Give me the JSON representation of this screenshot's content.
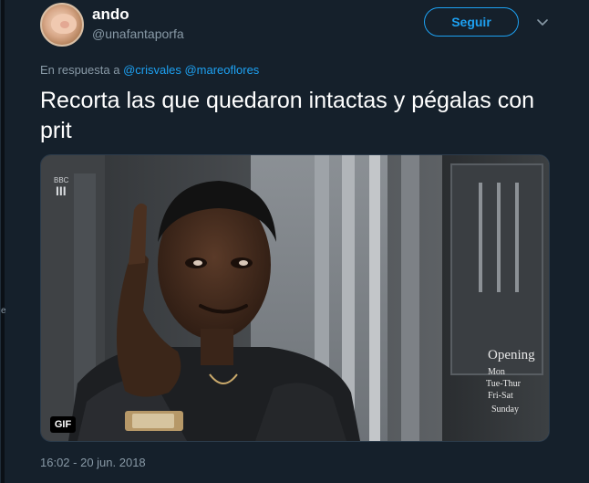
{
  "author": {
    "display_name": "ando",
    "handle": "@unafantaporfa"
  },
  "follow_label": "Seguir",
  "reply": {
    "prefix": "En respuesta a",
    "mentions": [
      "@crisvales",
      "@mareoflores"
    ]
  },
  "tweet_text": "Recorta las que quedaron intactas y pégalas con prit",
  "media": {
    "badge": "GIF",
    "logo_text": "BBC\nIII",
    "sign_lines": [
      "Opening",
      "Mon",
      "Tue-Thur",
      "Fri-Sat",
      "Sunday"
    ]
  },
  "timestamp": "16:02 - 20 jun. 2018",
  "left_edge_mark": "e",
  "colors": {
    "background": "#15202b",
    "accent": "#1da1f2",
    "secondary_text": "#8899a6",
    "primary_text": "#ffffff"
  },
  "icons": {
    "avatar": "avatar",
    "menu": "chevron-down-icon"
  }
}
